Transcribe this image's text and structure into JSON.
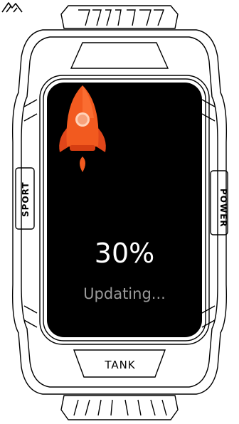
{
  "device": {
    "side_left_label": "SPORT",
    "side_right_label": "POWER",
    "bottom_plate_label": "TANK",
    "logo_icon": "brand-logo-icon"
  },
  "screen": {
    "progress_text": "30%",
    "progress_value": 30,
    "status_text": "Updating...",
    "icon": "rocket-icon"
  },
  "colors": {
    "screen_bg": "#000000",
    "rocket_orange": "#f25a1f",
    "text_primary": "#ffffff",
    "text_secondary": "#9a9a9a"
  }
}
